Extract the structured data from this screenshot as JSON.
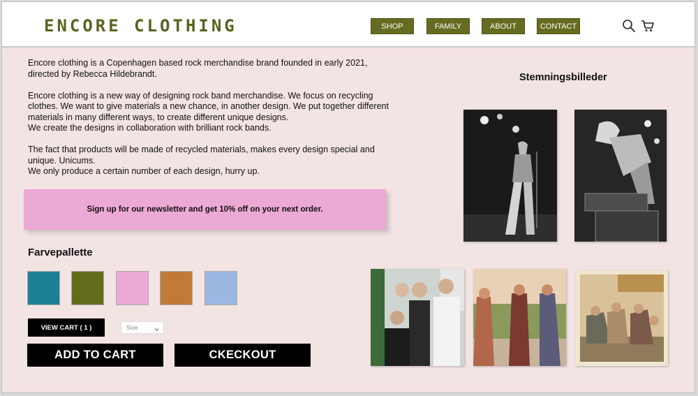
{
  "brand": {
    "name": "ENCORE CLOTHING"
  },
  "nav": {
    "items": [
      {
        "label": "SHOP"
      },
      {
        "label": "FAMILY"
      },
      {
        "label": "ABOUT"
      },
      {
        "label": "CONTACT"
      }
    ],
    "icons": [
      "search-icon",
      "cart-icon"
    ]
  },
  "intro": {
    "paragraphs": [
      "Encore clothing is a Copenhagen based rock merchandise brand founded in early 2021, directed by Rebecca Hildebrandt.",
      "Encore clothing is a new way of designing rock band merchandise. We focus on recycling clothes. We want to give materials a new chance, in another design. We put together different materials in many different ways, to create different unique designs.\nWe create the designs in collaboration with brilliant rock bands.",
      "The fact that products will be made of recycled materials, makes every design special and unique. Unicums.\nWe only produce a certain number of each design, hurry up."
    ]
  },
  "newsletter": {
    "text": "Sign up for our newsletter and get 10% off on your next order."
  },
  "palette": {
    "title": "Farvepallette",
    "colors": [
      "#1d8093",
      "#636b1d",
      "#eda9d6",
      "#c17a38",
      "#9db8e0"
    ]
  },
  "cart": {
    "view_cart_label": "VIEW CART ( 1 )",
    "size_placeholder": "Size",
    "add_to_cart_label": "ADD TO CART",
    "checkout_label": "CKECKOUT"
  },
  "gallery": {
    "title": "Stemningsbilleder"
  },
  "colors": {
    "accent_olive": "#666b21",
    "background": "#f2e4e3",
    "newsletter_pink": "#eda9d6"
  }
}
